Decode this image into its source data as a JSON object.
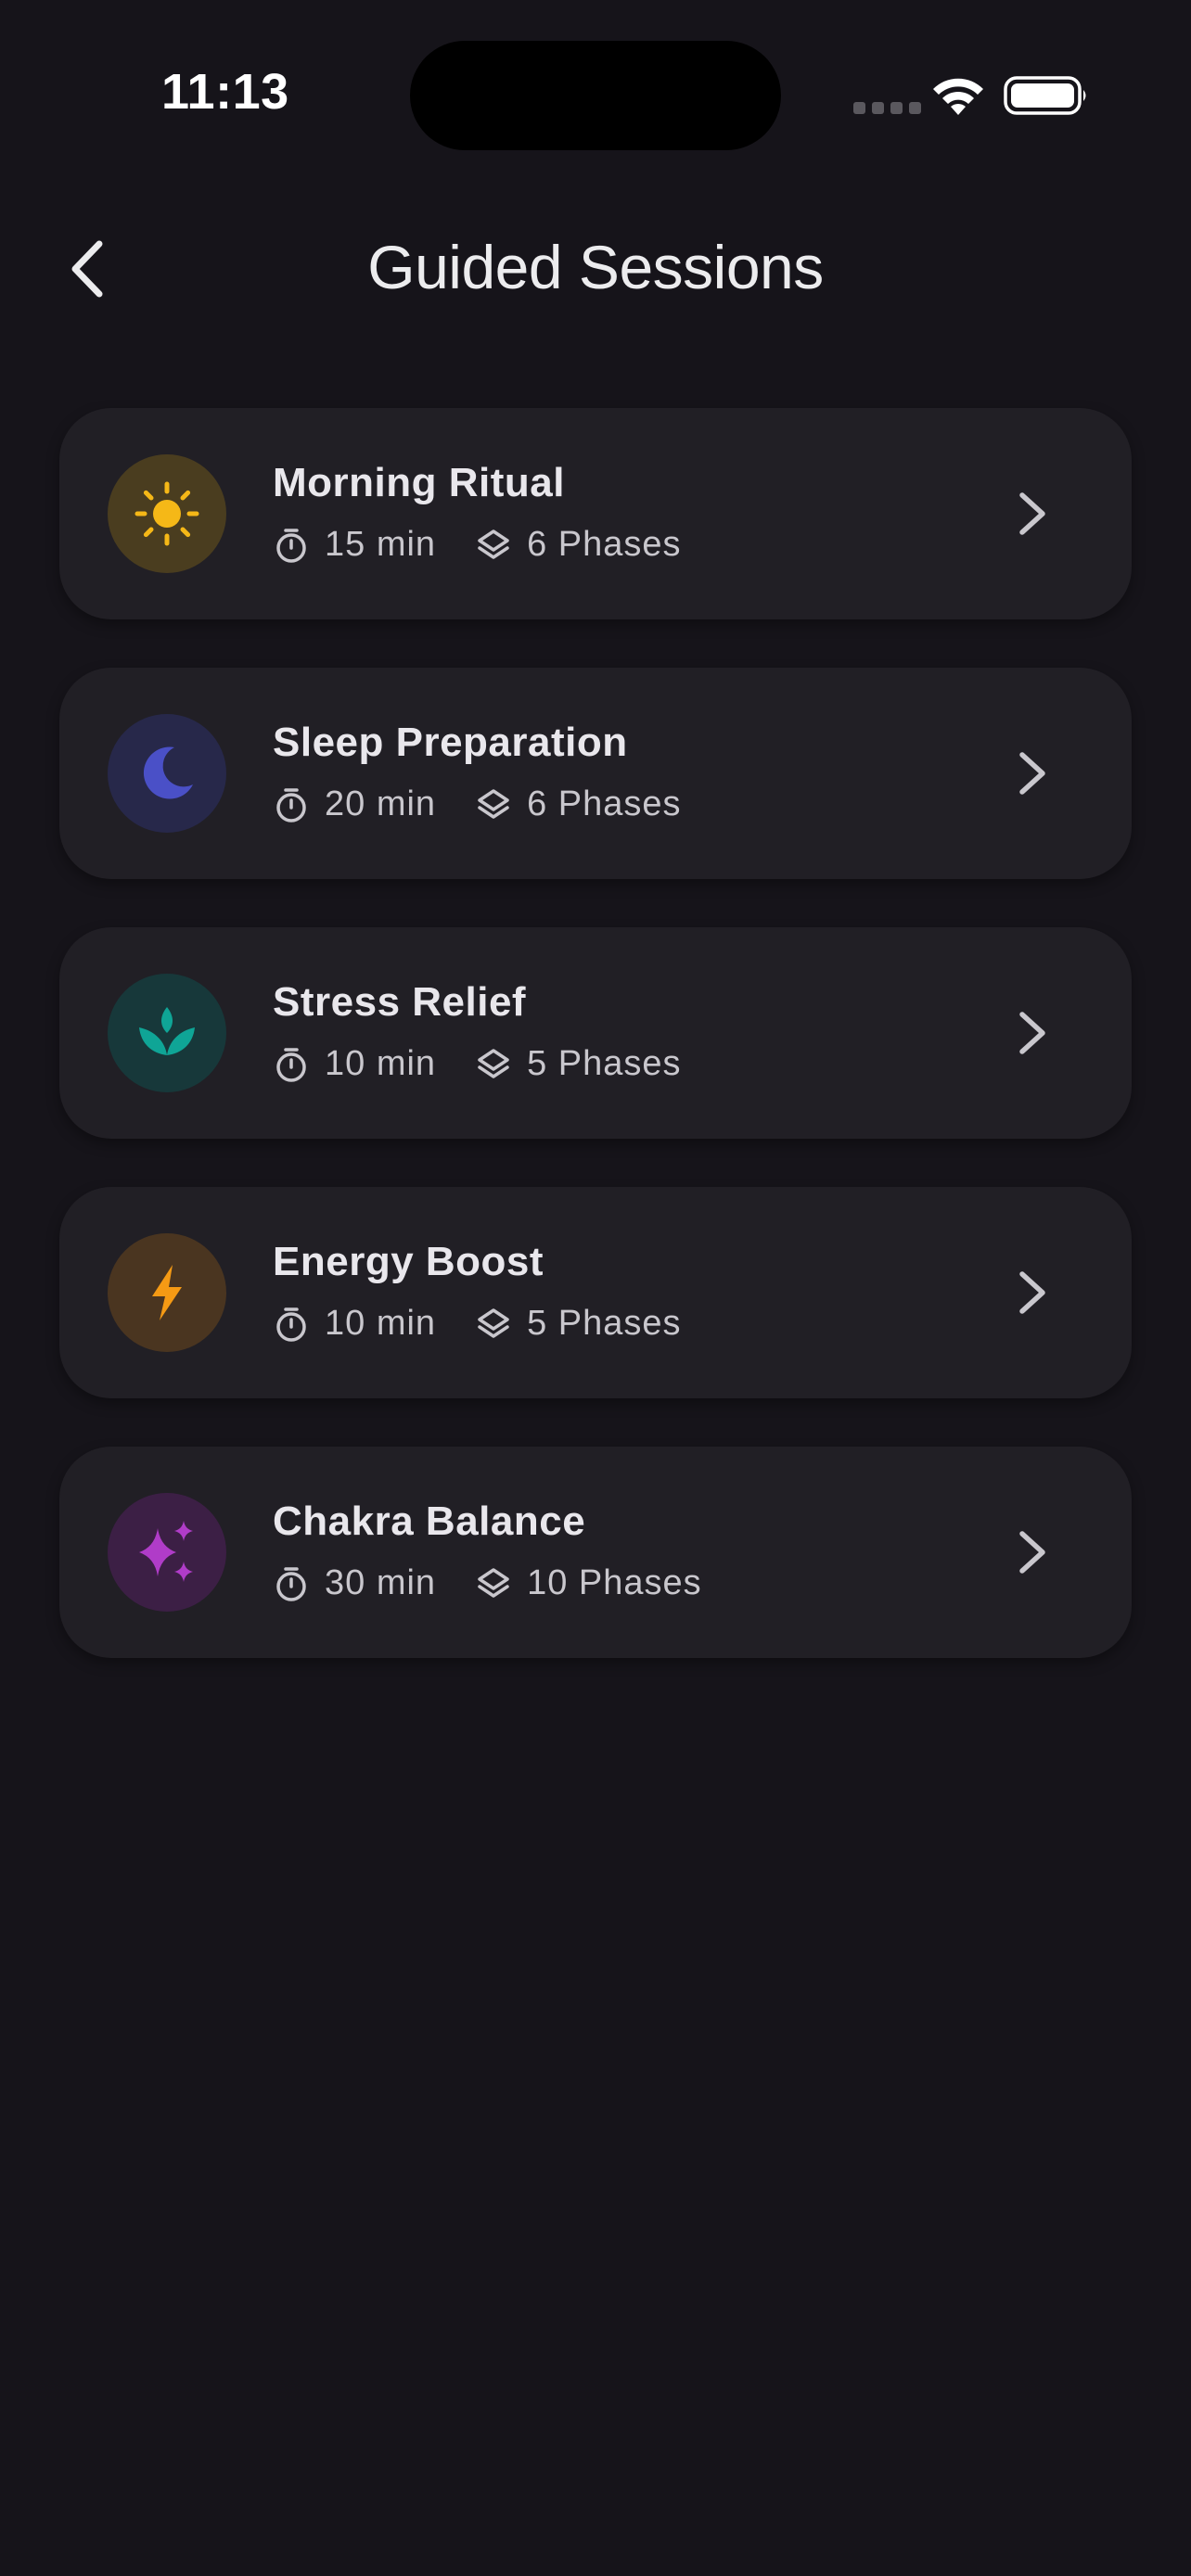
{
  "status_bar": {
    "time": "11:13"
  },
  "header": {
    "title": "Guided Sessions"
  },
  "colors": {
    "background": "#16141a",
    "card": "#211f25",
    "sun": "#f5b817",
    "moon": "#4a50c7",
    "lotus": "#0fa596",
    "bolt": "#f59a14",
    "sparkle": "#b03cc8"
  },
  "sessions": [
    {
      "title": "Morning Ritual",
      "duration": "15 min",
      "phases": "6 Phases",
      "icon": "sun-icon"
    },
    {
      "title": "Sleep Preparation",
      "duration": "20 min",
      "phases": "6 Phases",
      "icon": "moon-icon"
    },
    {
      "title": "Stress Relief",
      "duration": "10 min",
      "phases": "5 Phases",
      "icon": "lotus-icon"
    },
    {
      "title": "Energy Boost",
      "duration": "10 min",
      "phases": "5 Phases",
      "icon": "lightning-icon"
    },
    {
      "title": "Chakra Balance",
      "duration": "30 min",
      "phases": "10 Phases",
      "icon": "sparkles-icon"
    }
  ]
}
